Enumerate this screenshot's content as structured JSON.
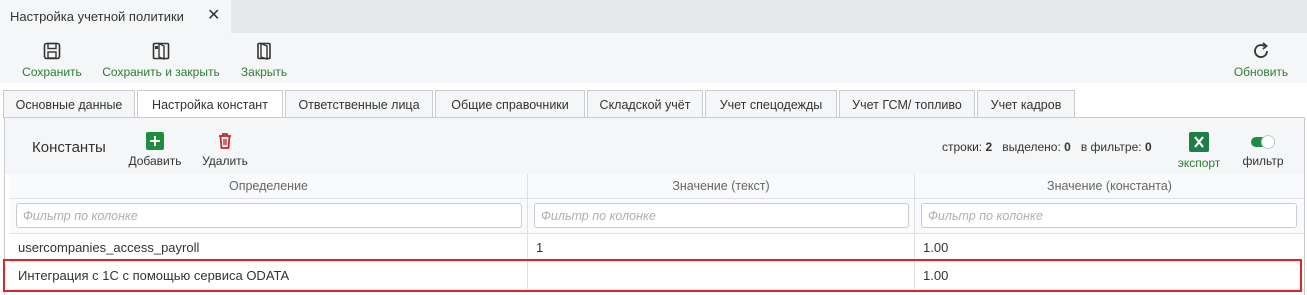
{
  "document_tab": {
    "title": "Настройка учетной политики",
    "close_icon": "close-icon"
  },
  "toolbar": {
    "save_label": "Сохранить",
    "save_close_label": "Сохранить и закрыть",
    "close_label": "Закрыть",
    "refresh_label": "Обновить"
  },
  "tabs": [
    {
      "label": "Основные данные",
      "active": false
    },
    {
      "label": "Настройка констант",
      "active": true
    },
    {
      "label": "Ответственные лица",
      "active": false
    },
    {
      "label": "Общие справочники",
      "active": false
    },
    {
      "label": "Складской учёт",
      "active": false
    },
    {
      "label": "Учет спецодежды",
      "active": false
    },
    {
      "label": "Учет ГСМ/ топливо",
      "active": false
    },
    {
      "label": "Учет кадров",
      "active": false
    }
  ],
  "panel": {
    "title": "Константы",
    "add_label": "Добавить",
    "delete_label": "Удалить",
    "stats": {
      "rows_label": "строки:",
      "rows_value": "2",
      "selected_label": "выделено:",
      "selected_value": "0",
      "filtered_label": "в фильтре:",
      "filtered_value": "0"
    },
    "export_label": "экспорт",
    "filter_label": "фильтр",
    "filter_toggle_on": true
  },
  "grid": {
    "columns": [
      "Определение",
      "Значение (текст)",
      "Значение (константа)"
    ],
    "filter_placeholder": "Фильтр по колонке",
    "rows": [
      [
        "usercompanies_access_payroll",
        "1",
        "1.00"
      ],
      [
        "Интеграция с 1С с помощью сервиса ODATA",
        "",
        "1.00"
      ]
    ],
    "highlighted_row": 1
  },
  "colors": {
    "accent_green": "#2e7d32",
    "delete_red": "#c62828",
    "highlight_border": "#d9262e",
    "excel_green": "#1e7e45"
  }
}
